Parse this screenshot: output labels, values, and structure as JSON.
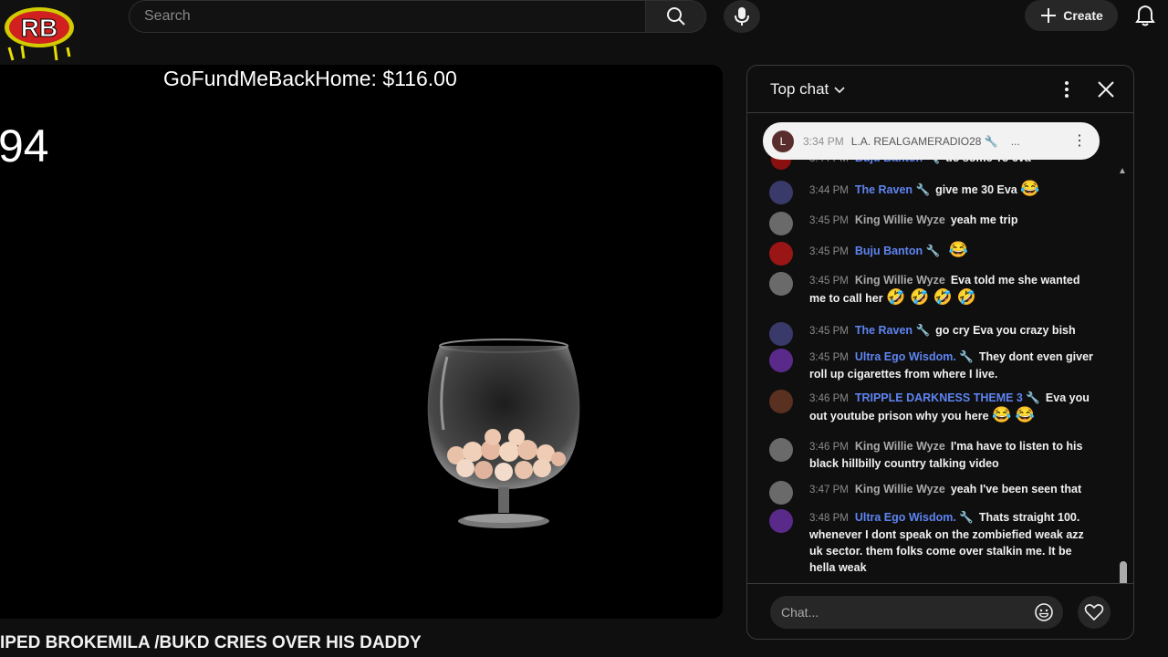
{
  "topbar": {
    "search_placeholder": "Search",
    "create_label": "Create"
  },
  "video": {
    "overlay_fund": "GoFundMeBackHome: $116.00",
    "overlay_number": "94",
    "title": "IPED BROKEMILA /BUKD CRIES OVER HIS DADDY"
  },
  "chat": {
    "mode_label": "Top chat",
    "input_placeholder": "Chat...",
    "pinned": {
      "avatar_letter": "L",
      "time": "3:34 PM",
      "author": "L.A. REALGAMERADIO28 🔧",
      "ellipsis": "..."
    },
    "messages": [
      {
        "time": "3:44 PM",
        "author": "Buju Banton 🔧",
        "text": "do some To eva",
        "emoji": "",
        "mod": true
      },
      {
        "time": "3:44 PM",
        "author": "The Raven 🔧",
        "text": "give me 30 Eva",
        "emoji": "😂",
        "mod": true
      },
      {
        "time": "3:45 PM",
        "author": "King Willie Wyze",
        "text": "yeah me trip",
        "emoji": "",
        "mod": false
      },
      {
        "time": "3:45 PM",
        "author": "Buju Banton 🔧",
        "text": "",
        "emoji": "😂",
        "mod": true
      },
      {
        "time": "3:45 PM",
        "author": "King Willie Wyze",
        "text": "Eva told me she wanted me to call her",
        "emoji": "🤣 🤣 🤣 🤣",
        "mod": false
      },
      {
        "time": "3:45 PM",
        "author": "The Raven 🔧",
        "text": "go cry Eva you crazy bish",
        "emoji": "",
        "mod": true
      },
      {
        "time": "3:45 PM",
        "author": "Ultra Ego Wisdom. 🔧",
        "text": "They dont even giver roll up cigarettes from where I live.",
        "emoji": "",
        "mod": true
      },
      {
        "time": "3:46 PM",
        "author": "TRIPPLE DARKNESS THEME 3 🔧",
        "text": "Eva you out youtube prison why you here",
        "emoji": "😂 😂",
        "mod": true
      },
      {
        "time": "3:46 PM",
        "author": "King Willie Wyze",
        "text": "I'ma have to listen to his black hillbilly country talking video",
        "emoji": "",
        "mod": false
      },
      {
        "time": "3:47 PM",
        "author": "King Willie Wyze",
        "text": "yeah I've been seen that",
        "emoji": "",
        "mod": false
      },
      {
        "time": "3:48 PM",
        "author": "Ultra Ego Wisdom. 🔧",
        "text": "Thats straight 100. whenever I dont speak on the zombiefied weak azz uk sector. them folks come over stalkin me. It be hella weak",
        "emoji": "",
        "mod": true
      }
    ]
  },
  "colors": {
    "moderator_name": "#5e84f1",
    "background": "#0f0f0f"
  },
  "icons": [
    "search-icon",
    "mic-icon",
    "plus-icon",
    "bell-icon",
    "chevron-down-icon",
    "more-vert-icon",
    "close-icon",
    "emoji-icon",
    "heart-icon"
  ]
}
